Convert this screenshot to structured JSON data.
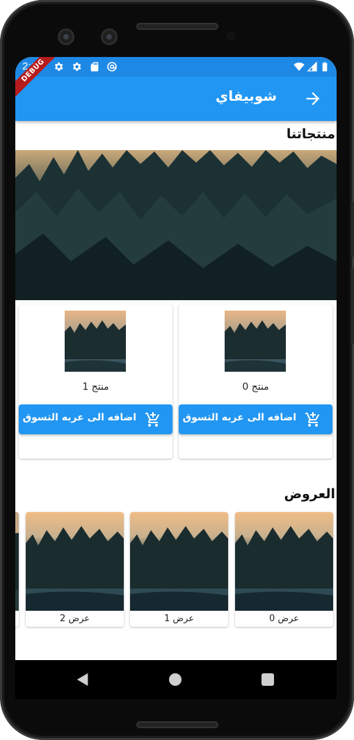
{
  "status_bar": {
    "time": "2:16",
    "icons": [
      "gear-icon",
      "gear-icon",
      "sd-card-icon",
      "at-sign-icon",
      "wifi-icon",
      "signal-icon",
      "battery-icon"
    ]
  },
  "debug_banner": "DEBUG",
  "app_bar": {
    "title": "شوبيفاي",
    "back_icon": "arrow-forward-icon"
  },
  "products_section": {
    "title": "منتجاتنا",
    "items": [
      {
        "name": "منتج 0",
        "button_label": "اضافه الى عربه التسوق",
        "button_icon": "add-shopping-cart-icon"
      },
      {
        "name": "منتج 1",
        "button_label": "اضافه الى عربه التسوق",
        "button_icon": "add-shopping-cart-icon"
      }
    ]
  },
  "offers_section": {
    "title": "العروض",
    "items": [
      {
        "name": "عرض 0"
      },
      {
        "name": "عرض 1"
      },
      {
        "name": "عرض 2"
      }
    ]
  },
  "nav_bar": {
    "back": "nav-back-icon",
    "home": "nav-home-icon",
    "recents": "nav-recents-icon"
  },
  "colors": {
    "primary": "#2196f3",
    "status_bar": "#1e88e5",
    "debug": "#b71c1c"
  }
}
